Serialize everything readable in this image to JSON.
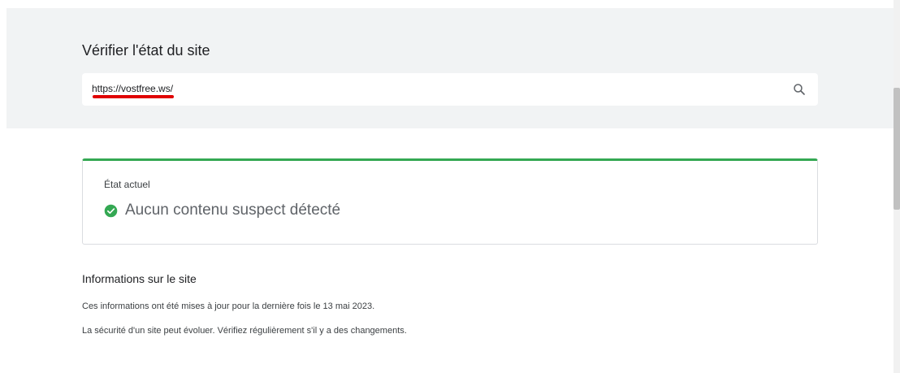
{
  "header": {
    "title": "Vérifier l'état du site"
  },
  "search": {
    "value": "https://vostfree.ws/",
    "icon": "search-icon"
  },
  "status_card": {
    "label": "État actuel",
    "status_text": "Aucun contenu suspect détecté",
    "icon": "check-circle-icon",
    "accent_color": "#34a853"
  },
  "site_info": {
    "title": "Informations sur le site",
    "updated_text": "Ces informations ont été mises à jour pour la dernière fois le 13 mai 2023.",
    "advice_text": "La sécurité d'un site peut évoluer. Vérifiez régulièrement s'il y a des changements."
  },
  "colors": {
    "annotation_underline": "#e00000",
    "band_background": "#f1f3f4"
  }
}
